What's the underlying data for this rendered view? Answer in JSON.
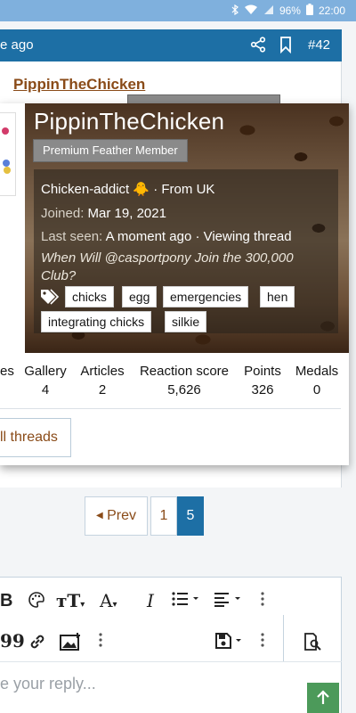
{
  "status_bar": {
    "battery": "96%",
    "time": "22:00"
  },
  "post_header": {
    "ago_text": "e ago",
    "post_number": "#42"
  },
  "underlying_post": {
    "author": "PippinTheChicken"
  },
  "member_card": {
    "username": "PippinTheChicken",
    "title": "Premium Feather Member",
    "bio": "Chicken-addict 🐥",
    "location_prefix": "· From ",
    "location": "UK",
    "joined_label": "Joined:",
    "joined_value": "Mar 19, 2021",
    "last_seen_label": "Last seen:",
    "last_seen_value": "A moment ago · Viewing thread",
    "signature": "When Will @casportpony Join the 300,000 Club?",
    "tags": [
      "chicks",
      "egg",
      "emergencies",
      "hen",
      "integrating chicks",
      "silkie"
    ],
    "stats": [
      {
        "label": "es",
        "value": ""
      },
      {
        "label": "Gallery",
        "value": "4"
      },
      {
        "label": "Articles",
        "value": "2"
      },
      {
        "label": "Reaction score",
        "value": "5,626"
      },
      {
        "label": "Points",
        "value": "326"
      },
      {
        "label": "Medals",
        "value": "0"
      }
    ],
    "find_threads_label": "ll threads"
  },
  "pagination": {
    "prev_label": "Prev",
    "pages": [
      "1",
      "5"
    ]
  },
  "editor": {
    "placeholder": "e your reply..."
  },
  "colors": {
    "brand_blue": "#1d6fa5",
    "link_brown": "#8a4b18",
    "submit_green": "#4c9a5a"
  }
}
